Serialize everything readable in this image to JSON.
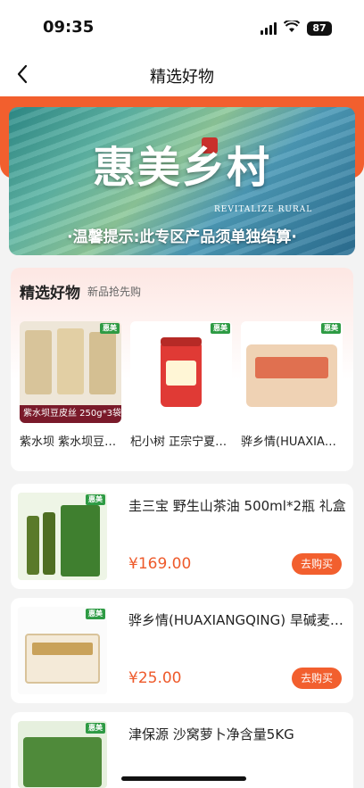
{
  "status": {
    "time": "09:35",
    "battery": "87"
  },
  "nav": {
    "title": "精选好物"
  },
  "banner": {
    "title": "惠美乡村",
    "subtitle": "REVITALIZE RURAL",
    "notice": "·温馨提示:此专区产品须单独结算·"
  },
  "featured": {
    "title": "精选好物",
    "subtitle": "新品抢先购",
    "items": [
      {
        "name": "紫水坝 紫水坝豆皮丝",
        "badge": "惠美",
        "caption": "紫水坝豆皮丝 250g*3袋"
      },
      {
        "name": "杞小树 正宗宁夏枸杞",
        "badge": "惠美"
      },
      {
        "name": "骅乡情(HUAXIANGQING)",
        "badge": "惠美"
      }
    ]
  },
  "products": [
    {
      "title": "圭三宝 野生山茶油 500ml*2瓶 礼盒",
      "price": "¥169.00",
      "button": "去购买",
      "badge": "惠美"
    },
    {
      "title": "骅乡情(HUAXIANGQING) 旱碱麦宽心面",
      "price": "¥25.00",
      "button": "去购买",
      "badge": "惠美"
    },
    {
      "title": "津保源 沙窝萝卜净含量5KG",
      "badge": "惠美"
    }
  ],
  "colors": {
    "accent": "#f25f2e",
    "price": "#ee5a2b",
    "badge": "#2e9b44"
  }
}
